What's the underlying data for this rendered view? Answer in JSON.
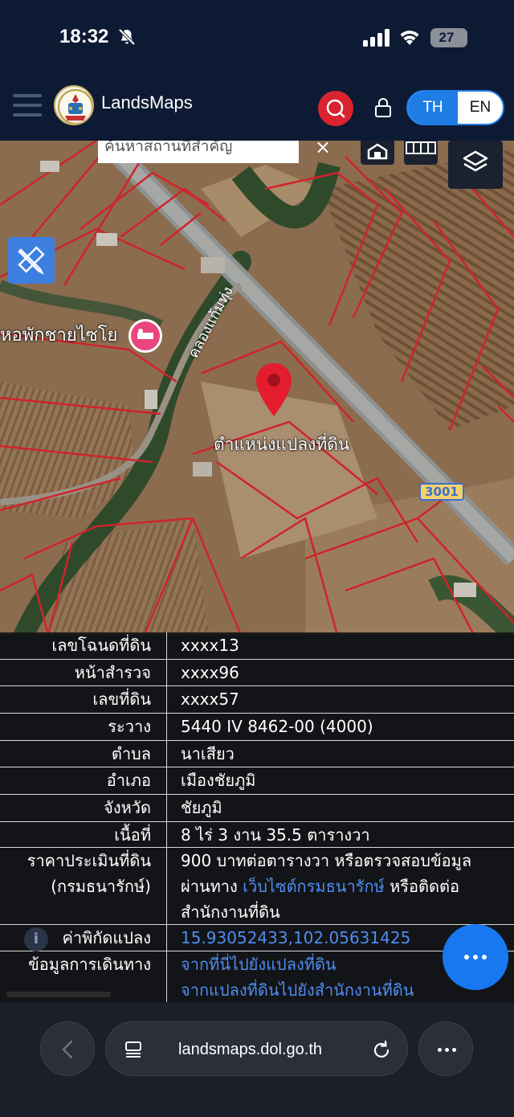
{
  "status": {
    "time": "18:32",
    "battery": "27"
  },
  "header": {
    "app_title": "LandsMaps",
    "lang_th": "TH",
    "lang_en": "EN"
  },
  "map": {
    "search_placeholder": "ค้นหาสถานที่สำคัญ",
    "search_clear": "×",
    "poi_label": "หอพักชายไซโย",
    "canal_label": "คลองแก้มทุ่ง",
    "parcel_label": "ตำแหน่งแปลงที่ดิน",
    "road_number": "3001"
  },
  "info": {
    "rows": [
      {
        "label": "เลขโฉนดที่ดิน",
        "value": "xxxx13"
      },
      {
        "label": "หน้าสำรวจ",
        "value": "xxxx96"
      },
      {
        "label": "เลขที่ดิน",
        "value": "xxxx57"
      },
      {
        "label": "ระวาง",
        "value": "5440 IV 8462-00 (4000)"
      },
      {
        "label": "ตำบล",
        "value": "นาเสียว"
      },
      {
        "label": "อำเภอ",
        "value": "เมืองชัยภูมิ"
      },
      {
        "label": "จังหวัด",
        "value": "ชัยภูมิ"
      },
      {
        "label": "เนื้อที่",
        "value": "8 ไร่ 3 งาน 35.5 ตารางวา"
      }
    ],
    "price_label_1": "ราคาประเมินที่ดิน",
    "price_label_2": "(กรมธนารักษ์)",
    "price_value_1": "900 บาทต่อตารางวา หรือตรวจสอบข้อมูล",
    "price_value_2a": "ผ่านทาง ",
    "price_link": "เว็บไซต์กรมธนารักษ์",
    "price_value_2b": " หรือติดต่อ",
    "price_value_3": "สำนักงานที่ดิน",
    "coord_label": "ค่าพิกัดแปลง",
    "coord_value": "15.93052433,102.05631425",
    "travel_label": "ข้อมูลการเดินทาง",
    "travel_link_1": "จากที่นี่ไปยังแปลงที่ดิน",
    "travel_link_2": "จากแปลงที่ดินไปยังสำนักงานที่ดิน",
    "info_badge": "i"
  },
  "browser": {
    "url": "landsmaps.dol.go.th"
  },
  "colors": {
    "header_bg": "#0d1a33",
    "accent_blue": "#1f7de6",
    "search_red": "#d9232f",
    "parcel_red": "#d1232a",
    "link_blue": "#4d8df0"
  }
}
